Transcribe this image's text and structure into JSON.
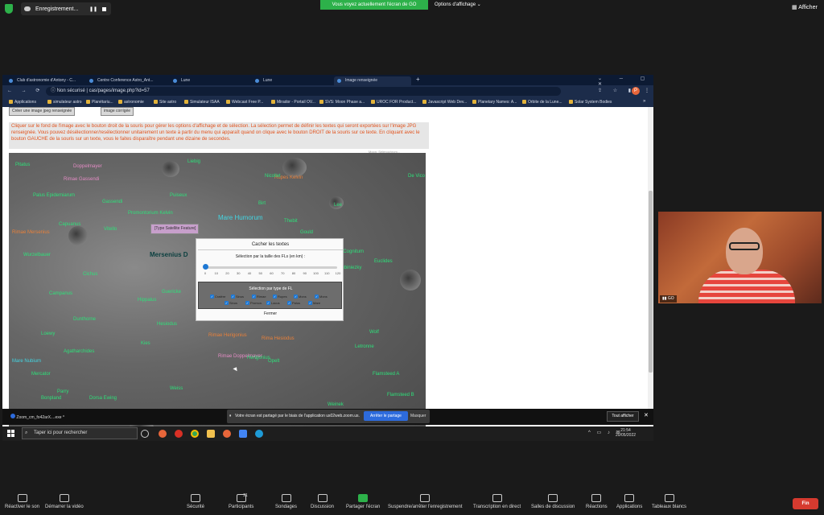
{
  "zoom": {
    "recording_label": "Enregistrement...",
    "share_banner": "Vous voyez actuellement l'écran de GO",
    "view_options": "Options d'affichage",
    "view_options_caret": "⌄",
    "show_label": "Afficher",
    "webcam_name": "GO",
    "toolbar": [
      {
        "label": "Réactiver le son",
        "icon": "microphone-muted-icon"
      },
      {
        "label": "Démarrer la vidéo",
        "icon": "video-off-icon"
      },
      {
        "label": "Sécurité",
        "icon": "shield-icon"
      },
      {
        "label": "Participants",
        "icon": "participants-icon",
        "count": "21"
      },
      {
        "label": "Sondages",
        "icon": "poll-icon"
      },
      {
        "label": "Discussion",
        "icon": "chat-icon"
      },
      {
        "label": "Partager l'écran",
        "icon": "share-screen-icon"
      },
      {
        "label": "Suspendre/arrêter l'enregistrement",
        "icon": "pause-record-icon"
      },
      {
        "label": "Transcription en direct",
        "icon": "cc-icon"
      },
      {
        "label": "Salles de discussion",
        "icon": "breakout-icon"
      },
      {
        "label": "Réactions",
        "icon": "reactions-icon"
      },
      {
        "label": "Applications",
        "icon": "apps-icon"
      },
      {
        "label": "Tableaux blancs",
        "icon": "whiteboard-icon"
      }
    ],
    "end_label": "Fin"
  },
  "browser": {
    "tabs": [
      "Club d'astronomie d'Antony - C...",
      "Centre Conference Astro_Ant...",
      "Lune",
      "Lune",
      "Image renseignée"
    ],
    "new_tab": "+",
    "security_label": "Non sécurisé",
    "url": "cas/pages/image.php?id=57",
    "bookmarks": [
      "Applications",
      "simulateur astro",
      "Planétariu...",
      "astronomie",
      "Site astro",
      "Simulateur ISAA",
      "Webcast Free P...",
      "Mirador - Portail OV...",
      "SVS: Moon Phase a...",
      "UROC FOR Product...",
      "Javascript Web Dev...",
      "Planetary Names: A...",
      "Orbite de la Lune...",
      "Solar System Bodies"
    ],
    "more_bookmarks": "»",
    "profile_initial": "P"
  },
  "page": {
    "btn_create": "Créer une image jpeg renseignée",
    "btn_corrige": "image corrigée",
    "info_text": "Cliquer sur le fond de l'image avec le bouton droit de la souris pour gérer les options d'affichage et de sélection. La sélection permet de définir les textes qui seront exportées sur l'image JPG renseignée. Vous pouvez désélectionner/resélectionner unitairement un texte à partir du menu qui apparaît quand on clique avec le bouton DROIT de la souris sur ce texte. En cliquant avec le bouton GAUCHE de la souris sur un texte, vous le faites disparaître pendant une dizaine de secondes.",
    "moon_labels": [
      {
        "t": "Mare Humorum",
        "c": "big"
      },
      {
        "t": "Mersenius D",
        "c": "dark"
      },
      {
        "t": "Promontorium Kelvin",
        "c": "green"
      },
      {
        "t": "Palus Epidemiarum",
        "c": "green"
      },
      {
        "t": "Rimae Mersenius",
        "c": "orange"
      },
      {
        "t": "Rupes Kelvin",
        "c": "orange"
      },
      {
        "t": "Mare Nubium",
        "c": "cyan"
      },
      {
        "t": "Gassendi",
        "c": "green"
      },
      {
        "t": "Vitello",
        "c": "green"
      },
      {
        "t": "Lee",
        "c": "green"
      },
      {
        "t": "Doppelmayer",
        "c": "pink"
      },
      {
        "t": "Liebig",
        "c": "green"
      },
      {
        "t": "Campanus",
        "c": "green"
      },
      {
        "t": "Mercator",
        "c": "green"
      },
      {
        "t": "Dunthorne",
        "c": "green"
      },
      {
        "t": "Hippalus",
        "c": "green"
      },
      {
        "t": "Kies",
        "c": "green"
      },
      {
        "t": "Bullialdus",
        "c": "green"
      },
      {
        "t": "Agatharchides",
        "c": "green"
      },
      {
        "t": "Rima Hesiodus",
        "c": "orange"
      },
      {
        "t": "Flamsteed A",
        "c": "green"
      },
      {
        "t": "Flamsteed B",
        "c": "green"
      },
      {
        "t": "Letronne",
        "c": "green"
      },
      {
        "t": "Wolf",
        "c": "green"
      },
      {
        "t": "Darney",
        "c": "green"
      },
      {
        "t": "Weinek",
        "c": "green"
      },
      {
        "t": "Mare Cognitum",
        "c": "green"
      },
      {
        "t": "Lubiniezky",
        "c": "green"
      },
      {
        "t": "Opelt",
        "c": "green"
      },
      {
        "t": "Gould",
        "c": "green"
      },
      {
        "t": "Euclides",
        "c": "green"
      },
      {
        "t": "Nicollet",
        "c": "green"
      },
      {
        "t": "Birt",
        "c": "green"
      },
      {
        "t": "Thebit",
        "c": "green"
      },
      {
        "t": "Pitatus",
        "c": "green"
      },
      {
        "t": "Wurzelbauer",
        "c": "green"
      },
      {
        "t": "Capuanus",
        "c": "green"
      },
      {
        "t": "Cichus",
        "c": "green"
      },
      {
        "t": "Weiss",
        "c": "green"
      },
      {
        "t": "Hesiodus",
        "c": "green"
      },
      {
        "t": "Rimae Doppelmayer",
        "c": "pink"
      },
      {
        "t": "Puiseux",
        "c": "green"
      },
      {
        "t": "Loewy",
        "c": "green"
      },
      {
        "t": "Rimae Gassendi",
        "c": "pink"
      },
      {
        "t": "Herigonius",
        "c": "green"
      },
      {
        "t": "Fra Mauro",
        "c": "green"
      },
      {
        "t": "Rimae Herigonius",
        "c": "orange"
      },
      {
        "t": "Guericke",
        "c": "green"
      },
      {
        "t": "Parry",
        "c": "green"
      },
      {
        "t": "Bonpland",
        "c": "green"
      },
      {
        "t": "Dorsa Ewing",
        "c": "green"
      },
      {
        "t": "De Vico",
        "c": "green"
      }
    ],
    "tooltip": "[Type Satellite Feature]",
    "dialog": {
      "title": "Cacher les textes",
      "subtitle": "Sélection par la taille des FLs (en km) :",
      "ticks": [
        "0",
        "10",
        "20",
        "30",
        "40",
        "50",
        "60",
        "70",
        "80",
        "90",
        "100",
        "110",
        "120"
      ],
      "type_title": "Sélection par type de FL",
      "types_row1": [
        "Cratère",
        "Sinus",
        "Rimae",
        "Rupes",
        "Mons",
        "Mons"
      ],
      "types_row2": [
        "Sinus",
        "Promon.",
        "Lacus",
        "Palus",
        "Mare"
      ],
      "check_glyph": "✓",
      "close": "Fermer"
    },
    "page_corner_label": "Moon: Selenochrom..."
  },
  "downloads": {
    "file": "Zoom_cm_fo42arX....exe",
    "caret": "^",
    "close": "✕"
  },
  "notification": {
    "pause_glyph": "⏸",
    "text": "Votre écran est partagé par le biais de l'application us02web.zoom.us.",
    "stop": "Arrêter le partage",
    "hide": "Masquer"
  },
  "show_all": "Tout afficher",
  "taskbar": {
    "search_placeholder": "Taper ici pour rechercher",
    "time": "21:54",
    "date": "20/05/2022"
  },
  "colors": {
    "zoom_green": "#2db14a",
    "end_red": "#d63a2f",
    "info_orange": "#e1521c",
    "stop_share_blue": "#2d6bdc"
  }
}
